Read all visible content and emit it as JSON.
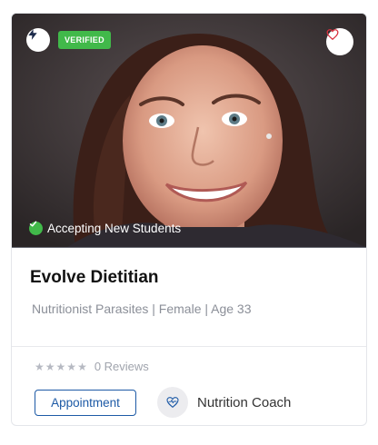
{
  "profile": {
    "verified_label": "VERIFIED",
    "status_text": "Accepting New Students",
    "name": "Evolve Dietitian",
    "meta": "Nutritionist Parasites | Female | Age 33",
    "rating": 0,
    "max_rating": 5,
    "reviews_text": "0 Reviews",
    "appointment_label": "Appointment",
    "role_label": "Nutrition Coach"
  },
  "icons": {
    "top_left": "lightning-bolt-icon",
    "favorite": "heart-icon",
    "status": "check-circle-icon",
    "role": "heart-pulse-icon"
  },
  "colors": {
    "verified_green": "#41b94a",
    "primary_blue": "#1d5aa6",
    "heart_red": "#d9303e",
    "star_grey": "#b6b9c2"
  }
}
